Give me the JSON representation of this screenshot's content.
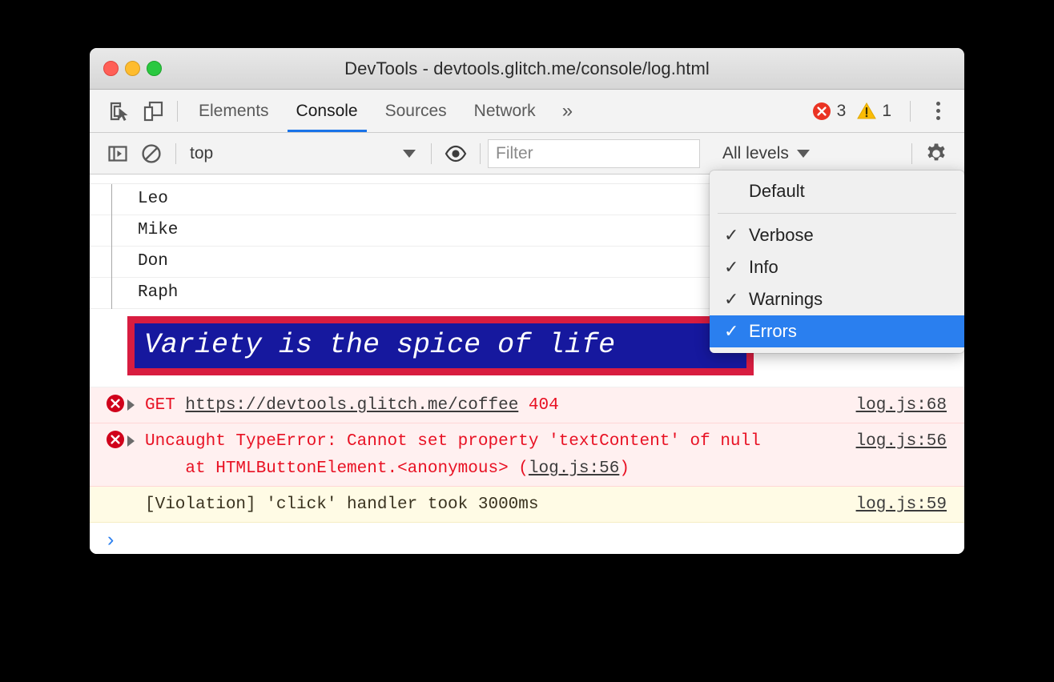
{
  "window": {
    "title": "DevTools - devtools.glitch.me/console/log.html",
    "traffic_lights": [
      "close",
      "minimize",
      "maximize"
    ]
  },
  "tabstrip": {
    "inspect_icon": "inspect-element-icon",
    "device_icon": "device-toolbar-icon",
    "tabs": [
      {
        "label": "Elements",
        "active": false
      },
      {
        "label": "Console",
        "active": true
      },
      {
        "label": "Sources",
        "active": false
      },
      {
        "label": "Network",
        "active": false
      }
    ],
    "more_tabs_label": "»",
    "error_count": "3",
    "warning_count": "1",
    "menu_icon": "kebab-menu-icon"
  },
  "console_toolbar": {
    "sidebar_icon": "console-sidebar-icon",
    "clear_icon": "clear-console-icon",
    "context_value": "top",
    "eye_icon": "live-expression-eye-icon",
    "filter_placeholder": "Filter",
    "filter_value": "",
    "levels_label": "All levels",
    "settings_icon": "settings-gear-icon"
  },
  "levels_menu": {
    "open": true,
    "items": [
      {
        "label": "Default",
        "checked": false,
        "selected": false
      },
      {
        "label": "Verbose",
        "checked": true,
        "selected": false
      },
      {
        "label": "Info",
        "checked": true,
        "selected": false
      },
      {
        "label": "Warnings",
        "checked": true,
        "selected": false
      },
      {
        "label": "Errors",
        "checked": true,
        "selected": true
      }
    ],
    "check_glyph": "✓"
  },
  "console": {
    "group_items": [
      "Leo",
      "Mike",
      "Don",
      "Raph"
    ],
    "styled_message": "Variety is the spice of life",
    "styled_colors": {
      "background": "#16189e",
      "border": "#d81d40",
      "text": "#ffffff"
    },
    "entries": [
      {
        "kind": "error",
        "icon": "error-circle-icon",
        "expandable": true,
        "method": "GET",
        "url": "https://devtools.glitch.me/coffee",
        "status": "404",
        "source": "log.js:68"
      },
      {
        "kind": "error",
        "icon": "error-circle-icon",
        "expandable": true,
        "message": "Uncaught TypeError: Cannot set property 'textContent' of null",
        "stack_prefix": "    at HTMLButtonElement.<anonymous> (",
        "stack_link": "log.js:56",
        "stack_suffix": ")",
        "source": "log.js:56"
      },
      {
        "kind": "warning",
        "message": "[Violation] 'click' handler took 3000ms",
        "source": "log.js:59"
      }
    ],
    "prompt_glyph": "›"
  },
  "colors": {
    "accent_blue": "#1a73e8",
    "selection_blue": "#2a7fef",
    "error_red": "#e81123",
    "error_bg": "#fff0f0",
    "warning_bg": "#fffbe5"
  }
}
